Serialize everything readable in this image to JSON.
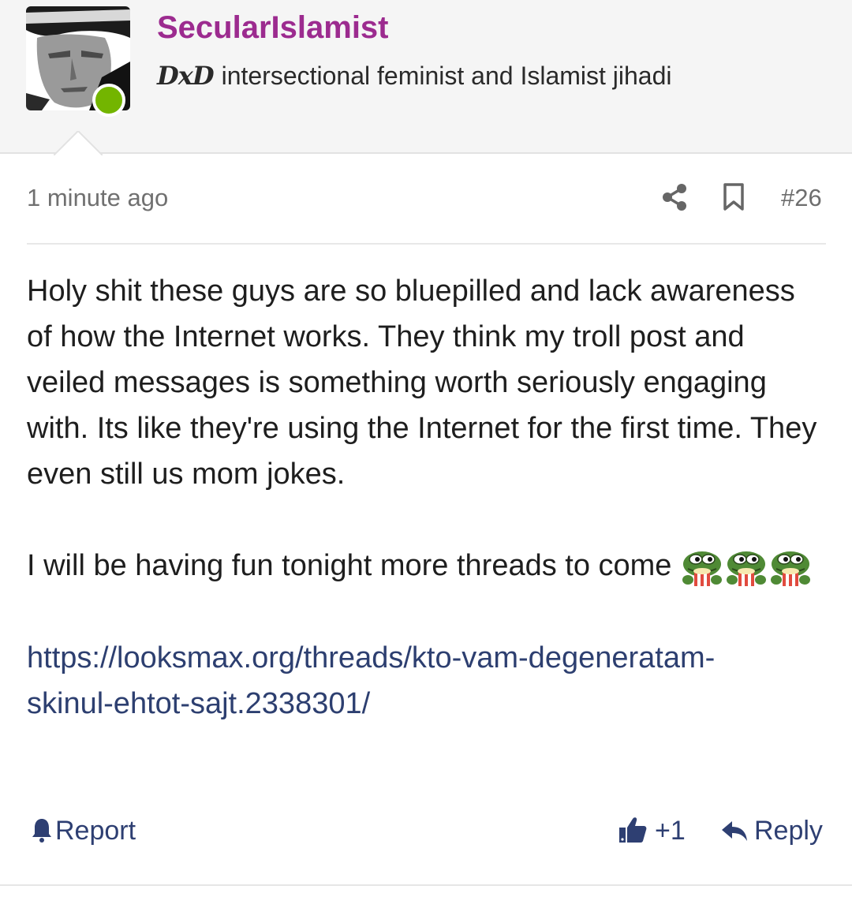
{
  "user": {
    "username": "SecularIslamist",
    "title_prefix": "DxD",
    "title_text": "intersectional feminist and Islamist jihadi",
    "online_color": "#73b500",
    "username_color": "#9c2b8f"
  },
  "post": {
    "time": "1 minute ago",
    "number": "#26",
    "paragraph1": "Holy shit these guys are so bluepilled and lack awareness of how the Internet works. They think my troll post and veiled messages is something worth seriously engaging with. Its like they're using the Internet for the first time. They even still us mom jokes.",
    "paragraph2": "I will be having fun tonight more threads to come",
    "emoji_name": "pepe-popcorn-emoji",
    "emoji_count": 3,
    "link_part1": "https://looksmax.org/threads/kto-vam-degeneratam-",
    "link_part2": "skinul-ehtot-sajt.2338301/"
  },
  "actions": {
    "report_label": "Report",
    "like_count": "+1",
    "reply_label": "Reply",
    "accent_color": "#2e3f72"
  },
  "icons": [
    "share-icon",
    "bookmark-icon",
    "bell-icon",
    "thumbs-up-icon",
    "reply-arrow-icon"
  ]
}
